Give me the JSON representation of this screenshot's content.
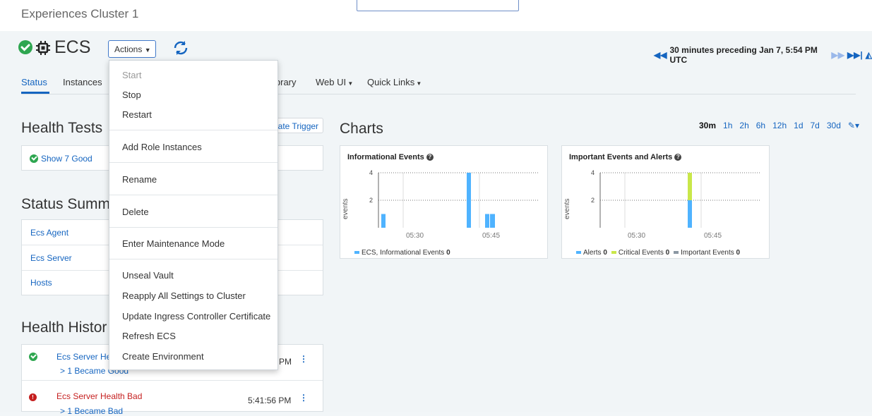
{
  "cluster": {
    "title": "Experiences Cluster 1"
  },
  "service": {
    "name": "ECS",
    "actions_label": "Actions"
  },
  "timeline": {
    "label": "30 minutes preceding Jan 7, 5:54 PM UTC"
  },
  "tabs": [
    {
      "label": "Status"
    },
    {
      "label": "Instances"
    },
    {
      "label": "ibrary"
    },
    {
      "label": "Web UI"
    },
    {
      "label": "Quick Links"
    }
  ],
  "health_tests": {
    "title": "Health Tests",
    "show_good": "Show 7 Good",
    "create_trigger": "eate Trigger"
  },
  "status_summary": {
    "title": "Status Summ",
    "items": [
      "Ecs Agent",
      "Ecs Server",
      "Hosts"
    ]
  },
  "health_history": {
    "title": "Health Histor",
    "rows": [
      {
        "title": "Ecs Server He",
        "detail": "> 1 Became Good",
        "time": "PM"
      },
      {
        "title": "Ecs Server Health Bad",
        "detail": "> 1 Became Bad",
        "time": "5:41:56 PM"
      }
    ]
  },
  "charts": {
    "title": "Charts",
    "ranges": [
      "30m",
      "1h",
      "2h",
      "6h",
      "12h",
      "1d",
      "7d",
      "30d"
    ],
    "active_range": "30m"
  },
  "menu": {
    "items": [
      {
        "label": "Start",
        "enabled": false
      },
      {
        "label": "Stop",
        "enabled": true
      },
      {
        "label": "Restart",
        "enabled": true
      },
      {
        "label": "Add Role Instances",
        "enabled": true
      },
      {
        "label": "Rename",
        "enabled": true
      },
      {
        "label": "Delete",
        "enabled": true
      },
      {
        "label": "Enter Maintenance Mode",
        "enabled": true
      },
      {
        "label": "Unseal Vault",
        "enabled": true
      },
      {
        "label": "Reapply All Settings to Cluster",
        "enabled": true
      },
      {
        "label": "Update Ingress Controller Certificate",
        "enabled": true
      },
      {
        "label": "Refresh ECS",
        "enabled": true
      },
      {
        "label": "Create Environment",
        "enabled": true
      }
    ]
  },
  "chart_data": [
    {
      "type": "bar",
      "title": "Informational Events",
      "ylabel": "events",
      "x_ticks": [
        "05:30",
        "05:45"
      ],
      "y_ticks": [
        2,
        4
      ],
      "ylim": [
        0,
        4
      ],
      "series": [
        {
          "name": "ECS, Informational Events",
          "total": 0,
          "color": "#4fb3ff",
          "points": [
            1,
            4,
            1
          ]
        }
      ]
    },
    {
      "type": "bar",
      "title": "Important Events and Alerts",
      "ylabel": "events",
      "x_ticks": [
        "05:30",
        "05:45"
      ],
      "y_ticks": [
        2,
        4
      ],
      "ylim": [
        0,
        4
      ],
      "series": [
        {
          "name": "Alerts",
          "total": 0,
          "color": "#4fb3ff",
          "points": [
            2
          ]
        },
        {
          "name": "Critical Events",
          "total": 0,
          "color": "#c9e74a",
          "points": [
            2
          ]
        },
        {
          "name": "Important Events",
          "total": 0,
          "color": "#8b97a3",
          "points": [
            0
          ]
        }
      ]
    }
  ]
}
